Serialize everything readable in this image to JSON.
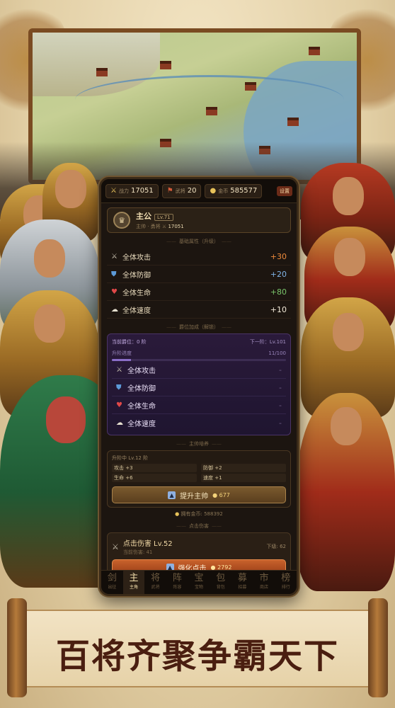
{
  "topbar": {
    "power_label": "战力",
    "power_value": "17051",
    "general_label": "武将",
    "general_value": "20",
    "gold_label": "金币",
    "gold_value": "585577",
    "settings_label": "设置"
  },
  "lord": {
    "name": "主公",
    "level": "Lv.71",
    "sub_label": "主帅 · 勇将",
    "power_value": "17051"
  },
  "base_bonus": {
    "title": "基础属性（升级）",
    "stats": [
      {
        "label": "全体攻击",
        "value": "+30"
      },
      {
        "label": "全体防御",
        "value": "+20"
      },
      {
        "label": "全体生命",
        "value": "+80"
      },
      {
        "label": "全体速度",
        "value": "+10"
      }
    ]
  },
  "rank_bonus": {
    "title": "爵位加成（解锁）",
    "rank_label": "当前爵位：0 阶",
    "rank_req": "下一阶：Lv.101",
    "progress_label": "升阶进度",
    "progress_text": "11/100",
    "progress_fraction": 0.11,
    "stats": [
      {
        "label": "全体攻击",
        "value": "-"
      },
      {
        "label": "全体防御",
        "value": "-"
      },
      {
        "label": "全体生命",
        "value": "-"
      },
      {
        "label": "全体速度",
        "value": "-"
      }
    ]
  },
  "general": {
    "title": "主帅培养",
    "head": "升阶中 Lv.12 阶",
    "stats": [
      "攻击 +3",
      "防御 +2",
      "生命 +6",
      "速度 +1"
    ],
    "upgrade_label": "提升主帅",
    "upgrade_cost": "677",
    "coin_text": "拥有金币: 588392"
  },
  "skill": {
    "title": "点击伤害",
    "name": "点击伤害 Lv.52",
    "sub": "当前伤害: 41",
    "next": "下级: 62",
    "button_label": "强化点击",
    "button_cost": "2792"
  },
  "nav": [
    {
      "char": "剑",
      "label": "出征"
    },
    {
      "char": "主",
      "label": "主角"
    },
    {
      "char": "将",
      "label": "武将"
    },
    {
      "char": "阵",
      "label": "阵容"
    },
    {
      "char": "宝",
      "label": "宝物"
    },
    {
      "char": "包",
      "label": "背包"
    },
    {
      "char": "募",
      "label": "招募"
    },
    {
      "char": "市",
      "label": "商店"
    },
    {
      "char": "榜",
      "label": "排行"
    }
  ],
  "banner": {
    "slogan": "百将齐聚争霸天下"
  },
  "colors": {
    "accent_orange": "#ef8b3c",
    "accent_blue": "#7fb3e6",
    "accent_green": "#7ac46a",
    "panel_bg": "#1c1510",
    "banner_text": "#4a1e10"
  }
}
